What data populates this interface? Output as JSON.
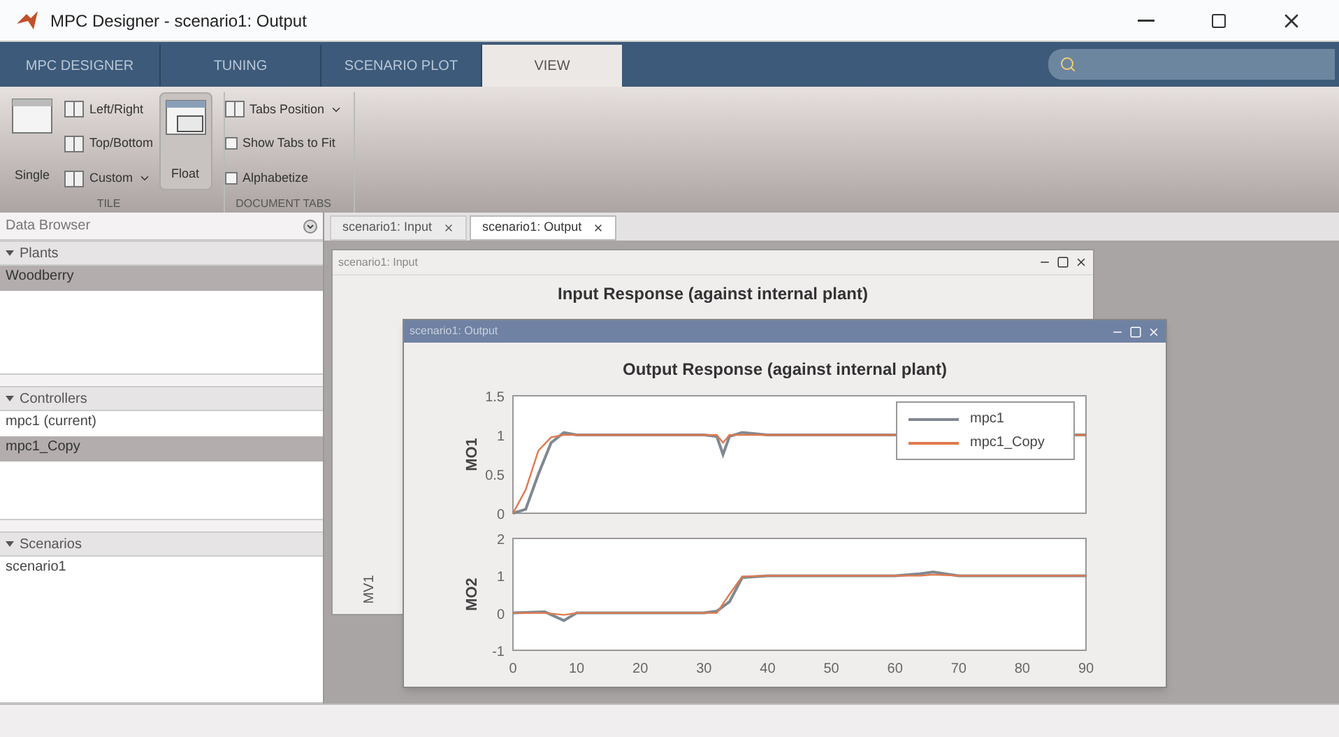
{
  "window": {
    "title": "MPC Designer - scenario1: Output"
  },
  "ribbon": {
    "tabs": [
      {
        "label": "MPC DESIGNER",
        "selected": false
      },
      {
        "label": "TUNING",
        "selected": false
      },
      {
        "label": "SCENARIO PLOT",
        "selected": false
      },
      {
        "label": "VIEW",
        "selected": true
      }
    ]
  },
  "toolstrip": {
    "groups": [
      {
        "label": "TILE",
        "items": [
          {
            "kind": "large",
            "label": "Single",
            "selected": false
          },
          {
            "kind": "small",
            "label": "Left/Right",
            "dropdown": false
          },
          {
            "kind": "small",
            "label": "Top/Bottom",
            "dropdown": false
          },
          {
            "kind": "small",
            "label": "Custom",
            "dropdown": true
          },
          {
            "kind": "large",
            "label": "Float",
            "selected": true
          }
        ]
      },
      {
        "label": "DOCUMENT TABS",
        "items": [
          {
            "kind": "small",
            "label": "Tabs Position",
            "dropdown": true
          },
          {
            "kind": "check",
            "label": "Show Tabs to Fit",
            "checked": false
          },
          {
            "kind": "check",
            "label": "Alphabetize",
            "checked": false
          }
        ]
      }
    ]
  },
  "data_browser": {
    "title": "Data Browser",
    "sections": [
      {
        "title": "Plants",
        "expanded": true,
        "items": [
          {
            "label": "Woodberry",
            "selected": true
          }
        ]
      },
      {
        "title": "Controllers",
        "expanded": true,
        "items": [
          {
            "label": "mpc1 (current)",
            "selected": false
          },
          {
            "label": "mpc1_Copy",
            "selected": true
          }
        ]
      },
      {
        "title": "Scenarios",
        "expanded": true,
        "items": [
          {
            "label": "scenario1",
            "selected": false
          }
        ]
      }
    ]
  },
  "documents": {
    "tabs": [
      {
        "label": "scenario1: Input",
        "selected": false
      },
      {
        "label": "scenario1: Output",
        "selected": true
      }
    ]
  },
  "input_window": {
    "title": "scenario1: Input",
    "plot_title": "Input Response (against internal plant)",
    "ylabel": "MV1"
  },
  "output_window": {
    "title": "scenario1: Output",
    "plot_title": "Output Response (against internal plant)",
    "charts": [
      {
        "chart_data": {
          "type": "line",
          "ylabel": "MO1",
          "x": [
            0,
            2,
            4,
            6,
            8,
            10,
            20,
            30,
            32,
            33,
            34,
            36,
            40,
            50,
            60,
            89,
            90
          ],
          "xlim": [
            0,
            90
          ],
          "ylim": [
            0,
            1.5
          ],
          "yticks": [
            0,
            0.5,
            1,
            1.5
          ],
          "series": [
            {
              "name": "mpc1",
              "color": "#808890",
              "values": [
                0,
                0.05,
                0.5,
                0.9,
                1.03,
                1,
                1,
                1,
                0.98,
                0.75,
                0.98,
                1.03,
                1,
                1,
                1,
                1,
                1
              ]
            },
            {
              "name": "mpc1_Copy",
              "color": "#e07a50",
              "values": [
                0,
                0.3,
                0.8,
                0.97,
                1,
                1,
                1,
                1,
                1,
                0.9,
                1,
                1,
                1,
                1,
                1,
                1,
                1
              ]
            }
          ]
        }
      },
      {
        "chart_data": {
          "type": "line",
          "ylabel": "MO2",
          "x": [
            0,
            5,
            8,
            10,
            20,
            30,
            32,
            34,
            36,
            40,
            50,
            60,
            64,
            66,
            70,
            80,
            90
          ],
          "xlim": [
            0,
            90
          ],
          "ylim": [
            -1,
            2
          ],
          "yticks": [
            -1,
            0,
            1,
            2
          ],
          "xticks": [
            0,
            10,
            20,
            30,
            40,
            50,
            60,
            70,
            80,
            90
          ],
          "series": [
            {
              "color": "#808890",
              "values": [
                0,
                0.03,
                -0.2,
                0,
                0,
                0,
                0.05,
                0.3,
                0.95,
                1,
                1,
                1,
                1.05,
                1.1,
                1,
                1,
                1
              ]
            },
            {
              "color": "#e07a50",
              "values": [
                0,
                0,
                -0.05,
                0,
                0,
                0,
                0,
                0.5,
                0.98,
                1,
                1,
                1,
                1,
                1.03,
                1,
                1,
                1
              ]
            }
          ]
        }
      }
    ]
  }
}
